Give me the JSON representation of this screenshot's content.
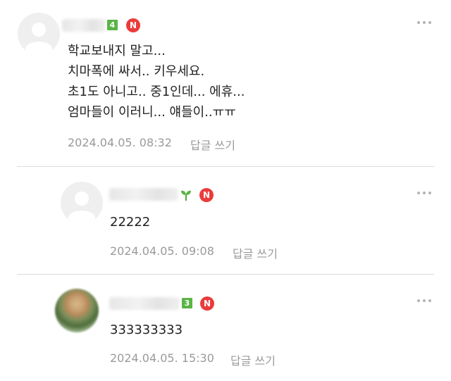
{
  "comments": [
    {
      "lines": [
        "학교보내지 말고...",
        "치마폭에 싸서.. 키우세요.",
        "초1도 아니고.. 중1인데... 에휴...",
        "엄마들이 이러니... 얘들이..ㅠㅠ"
      ],
      "date": "2024.04.05. 08:32",
      "reply_label": "답글 쓰기",
      "level_badge": "4",
      "new_badge": "N"
    },
    {
      "lines": [
        "22222"
      ],
      "date": "2024.04.05. 09:08",
      "reply_label": "답글 쓰기",
      "new_badge": "N"
    },
    {
      "lines": [
        "333333333"
      ],
      "date": "2024.04.05. 15:30",
      "reply_label": "답글 쓰기",
      "level_badge": "3",
      "new_badge": "N"
    }
  ],
  "icons": {
    "avatar_placeholder": "user-avatar-icon",
    "sprout": "sprout-icon",
    "more": "more-dots-icon"
  },
  "colors": {
    "new_badge": "#ea3b3b",
    "level_badge": "#5ab446",
    "meta_text": "#9a9a9a",
    "divider": "#dcdcdc"
  }
}
